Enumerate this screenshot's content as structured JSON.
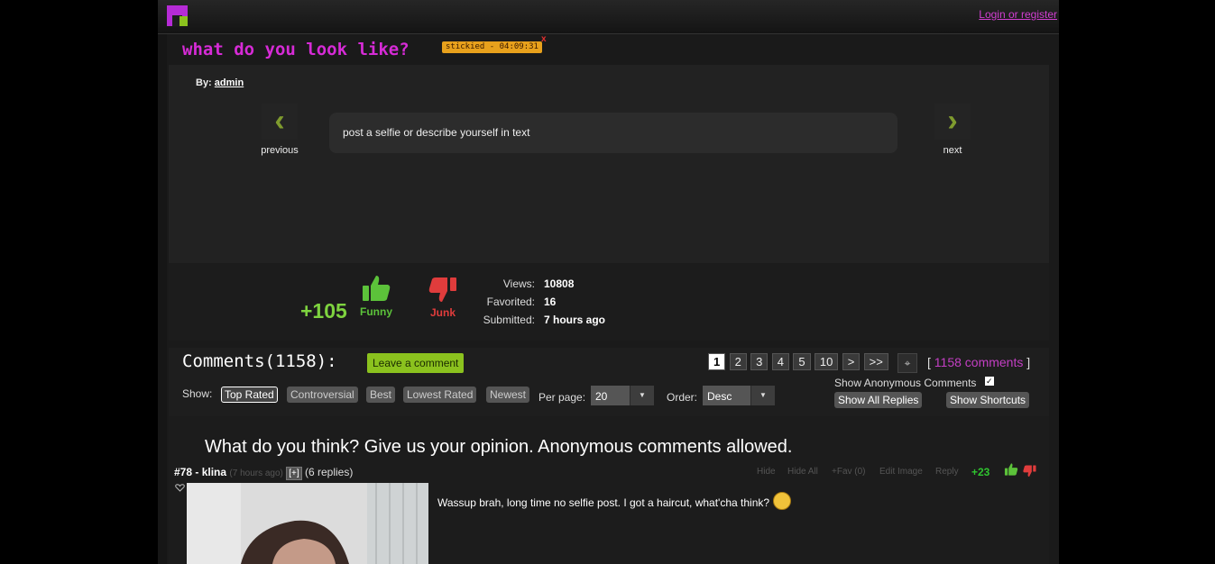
{
  "header": {
    "login_link": "Login or register"
  },
  "post": {
    "title": "what do you look like?",
    "sticky_badge": "stickied - 04:09:31",
    "close_glyph": "x",
    "by_label": "By:",
    "author": "admin",
    "prev_arrow": "‹",
    "next_arrow": "›",
    "prev_label": "previous",
    "next_label": "next",
    "text": "post a selfie or describe yourself in text",
    "score": "+105",
    "funny_label": "Funny",
    "junk_label": "Junk",
    "stats": {
      "views_label": "Views:",
      "views": "10808",
      "favorited_label": "Favorited:",
      "favorited": "16",
      "submitted_label": "Submitted:",
      "submitted": "7 hours ago"
    }
  },
  "comments_header": {
    "title": "Comments(1158):",
    "leave_comment": "Leave a comment",
    "pages": [
      "1",
      "2",
      "3",
      "4",
      "5",
      "10",
      ">",
      ">>"
    ],
    "target_glyph": "⌖",
    "count_open": "[",
    "count_link": "1158 comments",
    "count_close": "]",
    "show_label": "Show:",
    "filters": [
      "Top Rated",
      "Controversial",
      "Best",
      "Lowest Rated",
      "Newest"
    ],
    "per_page_label": "Per page:",
    "per_page_value": "20",
    "order_label": "Order:",
    "order_value": "Desc",
    "dropdown_glyph": "▼",
    "show_anonymous": "Show Anonymous Comments",
    "checkbox_glyph": "✓",
    "show_all_replies": "Show All Replies",
    "show_shortcuts": "Show Shortcuts"
  },
  "comments_body": {
    "prompt": "What do you think? Give us your opinion. Anonymous comments allowed.",
    "comment": {
      "number": "#78",
      "separator": " - ",
      "author": "klina",
      "time": "(7 hours ago)",
      "expand": "[+]",
      "replies": "(6 replies)",
      "actions": [
        "Hide",
        "Hide All",
        "+Fav (0)",
        "Edit Image",
        "Reply"
      ],
      "score": "+23",
      "text": "Wassup brah, long time no selfie post. I got a haircut, what'cha think?"
    }
  },
  "colors": {
    "accent_pink": "#d62bd6",
    "accent_green": "#8bc21e",
    "thumbs_up": "#5cc23a",
    "thumbs_down": "#e03c3c",
    "sticky": "#e8a11c"
  }
}
